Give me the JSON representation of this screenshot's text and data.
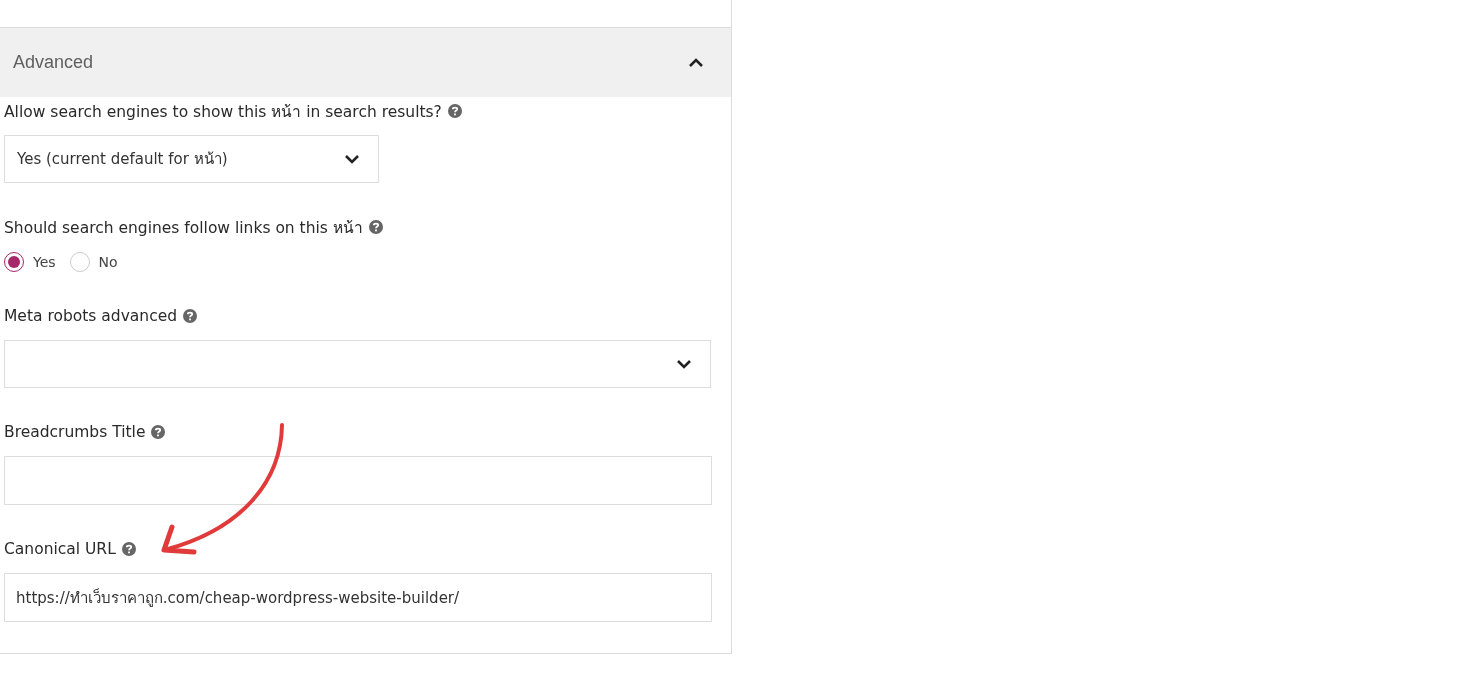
{
  "section": {
    "title": "Advanced",
    "expanded": true
  },
  "fields": [
    {
      "kind": "select",
      "label": "Allow search engines to show this หน้า in search results?",
      "value": "Yes (current default for หน้า)"
    },
    {
      "kind": "radio",
      "label": "Should search engines follow links on this หน้า",
      "options": [
        {
          "label": "Yes",
          "selected": true
        },
        {
          "label": "No",
          "selected": false
        }
      ]
    },
    {
      "kind": "select",
      "label": "Meta robots advanced"
    },
    {
      "kind": "text",
      "label": "Breadcrumbs Title"
    },
    {
      "kind": "text",
      "label": "Canonical URL",
      "value": "https://ทำเว็บราคาถูก.com/cheap-wordpress-website-builder/"
    }
  ]
}
